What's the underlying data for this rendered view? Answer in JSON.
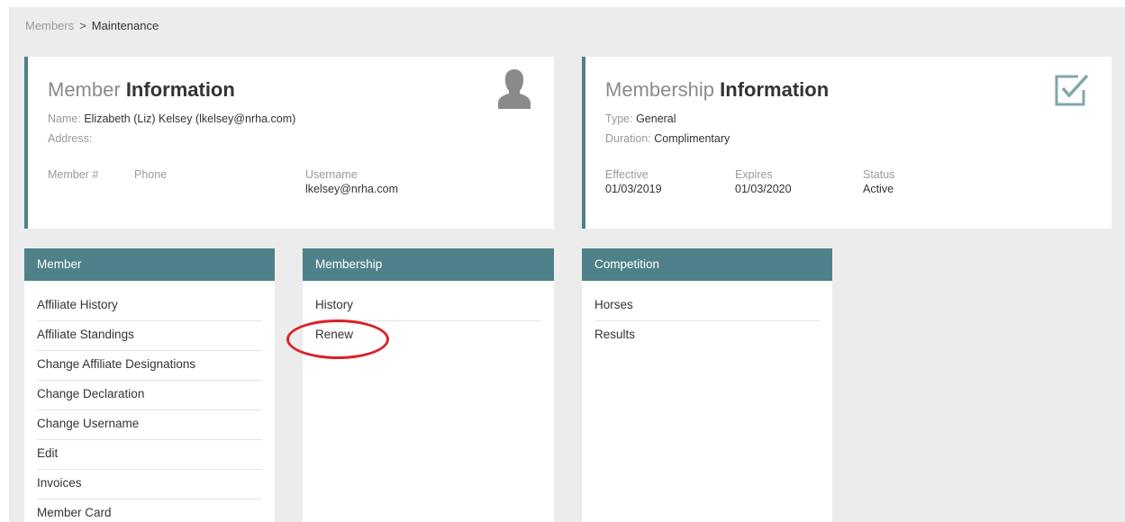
{
  "breadcrumb": {
    "parent": "Members",
    "separator": ">",
    "current": "Maintenance"
  },
  "member_info": {
    "title_light": "Member",
    "title_bold": "Information",
    "name_label": "Name:",
    "name_value": "Elizabeth (Liz) Kelsey (lkelsey@nrha.com)",
    "address_label": "Address:",
    "member_no_label": "Member #",
    "phone_label": "Phone",
    "username_label": "Username",
    "username_value": "lkelsey@nrha.com",
    "icon": "user-icon"
  },
  "membership_info": {
    "title_light": "Membership",
    "title_bold": "Information",
    "type_label": "Type:",
    "type_value": "General",
    "duration_label": "Duration:",
    "duration_value": "Complimentary",
    "effective_label": "Effective",
    "effective_value": "01/03/2019",
    "expires_label": "Expires",
    "expires_value": "01/03/2020",
    "status_label": "Status",
    "status_value": "Active",
    "icon": "checkbox-checked-icon"
  },
  "panels": {
    "member": {
      "header": "Member",
      "items": [
        "Affiliate History",
        "Affiliate Standings",
        "Change Affiliate Designations",
        "Change Declaration",
        "Change Username",
        "Edit",
        "Invoices",
        "Member Card"
      ]
    },
    "membership": {
      "header": "Membership",
      "items": [
        "History",
        "Renew"
      ]
    },
    "competition": {
      "header": "Competition",
      "items": [
        "Horses",
        "Results"
      ]
    }
  },
  "colors": {
    "accent": "#4e8189",
    "highlight": "#d8222a",
    "background": "#ececec"
  }
}
